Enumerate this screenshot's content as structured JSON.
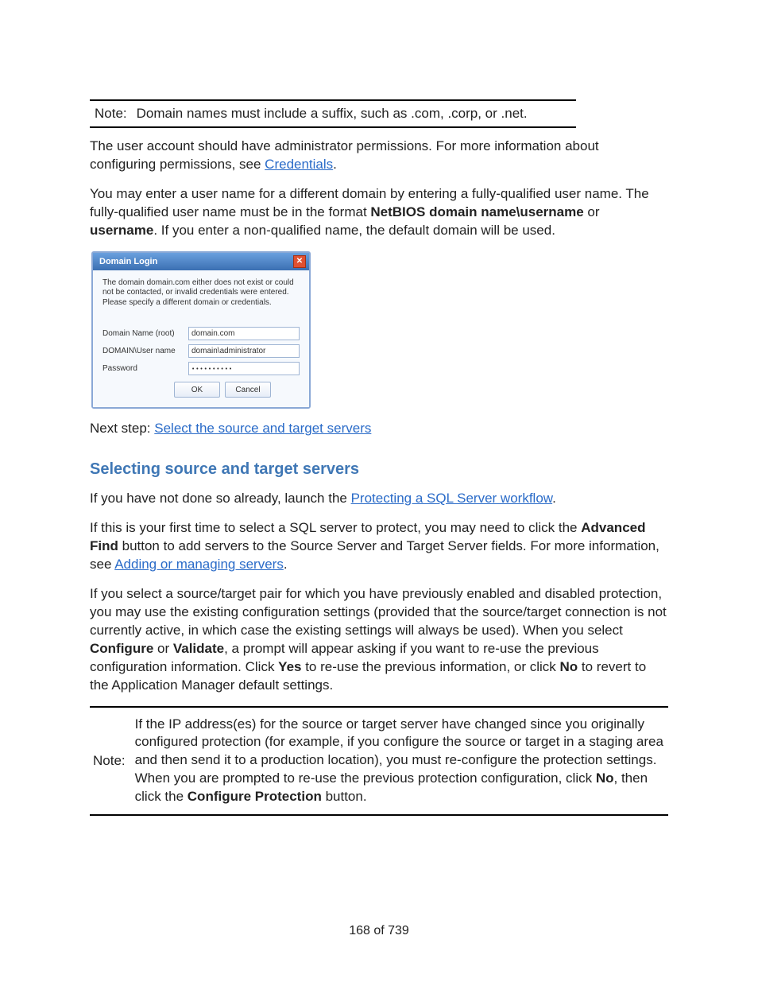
{
  "note1": {
    "label": "Note:",
    "text": "Domain names must include a suffix, such as .com, .corp, or .net."
  },
  "para1_a": "The user account should have administrator permissions. For more information about configuring permissions, see ",
  "para1_link": "Credentials",
  "para1_b": ".",
  "para2_a": "You may enter a user name for a different domain by entering a fully-qualified user name. The fully-qualified user name must be in the format ",
  "para2_bold1": "NetBIOS domain name\\username",
  "para2_mid": " or ",
  "para2_bold2": "username",
  "para2_b": ". If you enter a non-qualified name, the default domain will be used.",
  "dialog": {
    "title": "Domain Login",
    "message": "The domain domain.com either does not exist or could not be contacted, or invalid credentials were entered. Please specify a different domain or credentials.",
    "labels": {
      "domain": "Domain Name (root)",
      "user": "DOMAIN\\User name",
      "password": "Password"
    },
    "values": {
      "domain": "domain.com",
      "user": "domain\\administrator",
      "password": "••••••••••"
    },
    "buttons": {
      "ok": "OK",
      "cancel": "Cancel"
    }
  },
  "nextstep_label": "Next step: ",
  "nextstep_link": "Select the source and target servers",
  "section_heading": "Selecting source and target servers",
  "para3_a": "If you have not done so already, launch the ",
  "para3_link": "Protecting a SQL Server workflow",
  "para3_b": ".",
  "para4_a": "If this is your first time to select a SQL server to protect, you may need to click the ",
  "para4_bold": "Advanced Find",
  "para4_b": " button to add servers to the Source Server and Target Server fields. For more information, see ",
  "para4_link": "Adding or managing servers",
  "para4_c": ".",
  "para5_a": "If you select a source/target pair for which you have previously enabled and disabled protection, you may use the existing configuration settings (provided that the source/target connection is not currently active, in which case the existing settings will always be used). When you select ",
  "para5_bold1": "Configure",
  "para5_mid1": " or ",
  "para5_bold2": "Validate",
  "para5_b": ", a prompt will appear asking if you want to re-use the previous configuration information. Click ",
  "para5_bold3": "Yes",
  "para5_c": " to re-use the previous information, or click ",
  "para5_bold4": "No",
  "para5_d": " to revert to the Application Manager default settings.",
  "note2": {
    "label": "Note:",
    "text_a": "If the IP address(es) for the source or target server have changed since you originally configured protection (for example, if you configure the source or target in a staging area and then send it to a production location), you must re-configure the protection settings. When you are prompted to re-use the previous protection configuration, click ",
    "bold1": "No",
    "text_b": ", then click the ",
    "bold2": "Configure Protection",
    "text_c": " button."
  },
  "footer": "168 of 739"
}
